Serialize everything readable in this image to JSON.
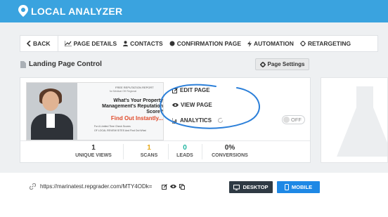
{
  "app": {
    "name": "LOCAL ANALYZER"
  },
  "nav": {
    "items": [
      {
        "label": "BACK",
        "icon": "chevron-left-icon"
      },
      {
        "label": "PAGE DETAILS",
        "icon": "line-chart-icon"
      },
      {
        "label": "CONTACTS",
        "icon": "user-icon"
      },
      {
        "label": "CONFIRMATION PAGE",
        "icon": "circle-icon"
      },
      {
        "label": "AUTOMATION",
        "icon": "bolt-icon"
      },
      {
        "label": "RETARGETING",
        "icon": "crosshair-icon"
      }
    ]
  },
  "section": {
    "title": "Landing Page Control",
    "settings_button": "Page Settings"
  },
  "preview": {
    "badge": "FREE REPUTATION REPORT",
    "badge_sub": "for Medical OH Regional",
    "headline": "What's Your Property Management's Reputation Score?",
    "cta": "Find Out Instantly...",
    "fine1": "For A Limited Time Check Scores",
    "fine2": "OF LOCAL REVIEW SITES And Find Out What"
  },
  "actions": {
    "edit": "EDIT PAGE",
    "view": "VIEW PAGE",
    "analytics": "ANALYTICS"
  },
  "toggle": {
    "label": "OFF"
  },
  "stats": [
    {
      "value": "1",
      "label": "UNIQUE VIEWS",
      "color": "#333333"
    },
    {
      "value": "1",
      "label": "SCANS",
      "color": "#e6a817"
    },
    {
      "value": "0",
      "label": "LEADS",
      "color": "#1fb5a0"
    },
    {
      "value": "0%",
      "label": "CONVERSIONS",
      "color": "#333333"
    }
  ],
  "url": {
    "value": "https://marinatest.repgrader.com/MTY4ODk="
  },
  "device_buttons": {
    "desktop": "DESKTOP",
    "mobile": "MOBILE"
  },
  "colors": {
    "topbar": "#3aa3df",
    "annotation": "#2b7fd9",
    "desktop_btn": "#2f3a44",
    "mobile_btn": "#1e88e5"
  }
}
